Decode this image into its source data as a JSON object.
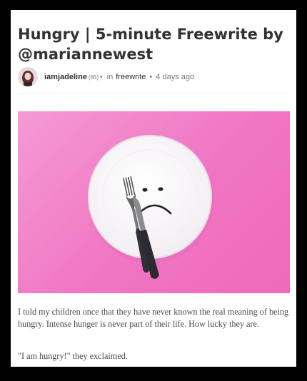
{
  "post": {
    "title": "Hungry | 5-minute Freewrite by @mariannewest",
    "author": "iamjadeline",
    "reputation": "(65)",
    "caret": "▾",
    "in_label": "in",
    "community": "freewrite",
    "separator": "•",
    "time": "4 days ago",
    "paragraphs": [
      "I told my children once that they have never known the real meaning of being hungry. Intense hunger is never part of their life. How lucky they are.",
      "\"I am hungry!\" they exclaimed."
    ]
  },
  "colors": {
    "image_pink": "#f075c3",
    "title_text": "#333333",
    "meta_text": "#777777"
  },
  "icons": {
    "author_menu": "chevron-down-icon",
    "image": "plate-with-fork-sad-face"
  }
}
